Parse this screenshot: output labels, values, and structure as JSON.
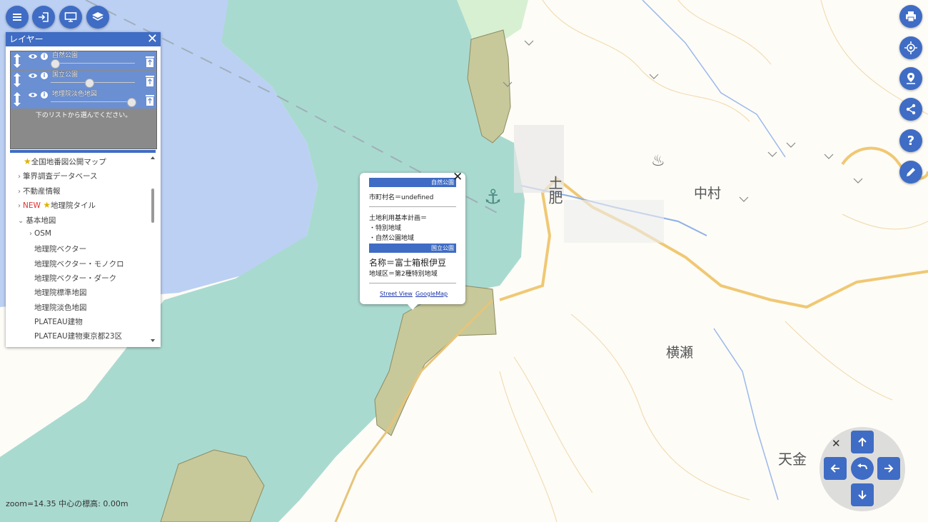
{
  "toolbar": {
    "menu_icon": "menu-icon",
    "login_icon": "login-icon",
    "display_icon": "monitor-icon",
    "layers_icon": "layers-icon"
  },
  "right_toolbar": [
    "print-icon",
    "locate-icon",
    "marker-icon",
    "share-icon",
    "help-icon",
    "edit-icon"
  ],
  "layer_panel": {
    "title": "レイヤー",
    "active_layers": [
      {
        "name": "自然公園",
        "opacity": 0.02
      },
      {
        "name": "国立公園",
        "opacity": 0.45
      },
      {
        "name": "地理院淡色地図",
        "opacity": 1.0
      }
    ],
    "hint": "下のリストから選んでください。",
    "list": {
      "item0": "全国地番図公開マップ",
      "item1": "筆界調査データベース",
      "item2": "不動産情報",
      "item3_new": "NEW",
      "item3": "地理院タイル",
      "item4": "基本地図",
      "item5": "OSM",
      "item6": "地理院ベクター",
      "item7": "地理院ベクター・モノクロ",
      "item8": "地理院ベクター・ダーク",
      "item9": "地理院標準地図",
      "item10": "地理院淡色地図",
      "item11": "PLATEAU建物",
      "item12": "PLATEAU建物東京都23区"
    }
  },
  "popup": {
    "section1_header": "自然公園",
    "city_line": "市町村名＝undefined",
    "landuse_title": "土地利用基本計画＝",
    "landuse_1": "・特別地域",
    "landuse_2": "・自然公園地域",
    "section2_header": "国立公園",
    "park_name": "名称＝富士箱根伊豆",
    "zone": "地域区＝第2種特別地域",
    "link_streetview": "Street View",
    "link_googlemap": "GoogleMap"
  },
  "map_labels": {
    "place1": "土肥",
    "place2": "中村",
    "place3": "横瀬",
    "place4": "天金"
  },
  "status": {
    "zoom_text": "zoom=14.35 中心の標高: 0.00m"
  },
  "colors": {
    "accent": "#3f6cc4",
    "sea": "#bcd0f4",
    "park": "#a9dad0",
    "national_park": "#c7c99a"
  }
}
